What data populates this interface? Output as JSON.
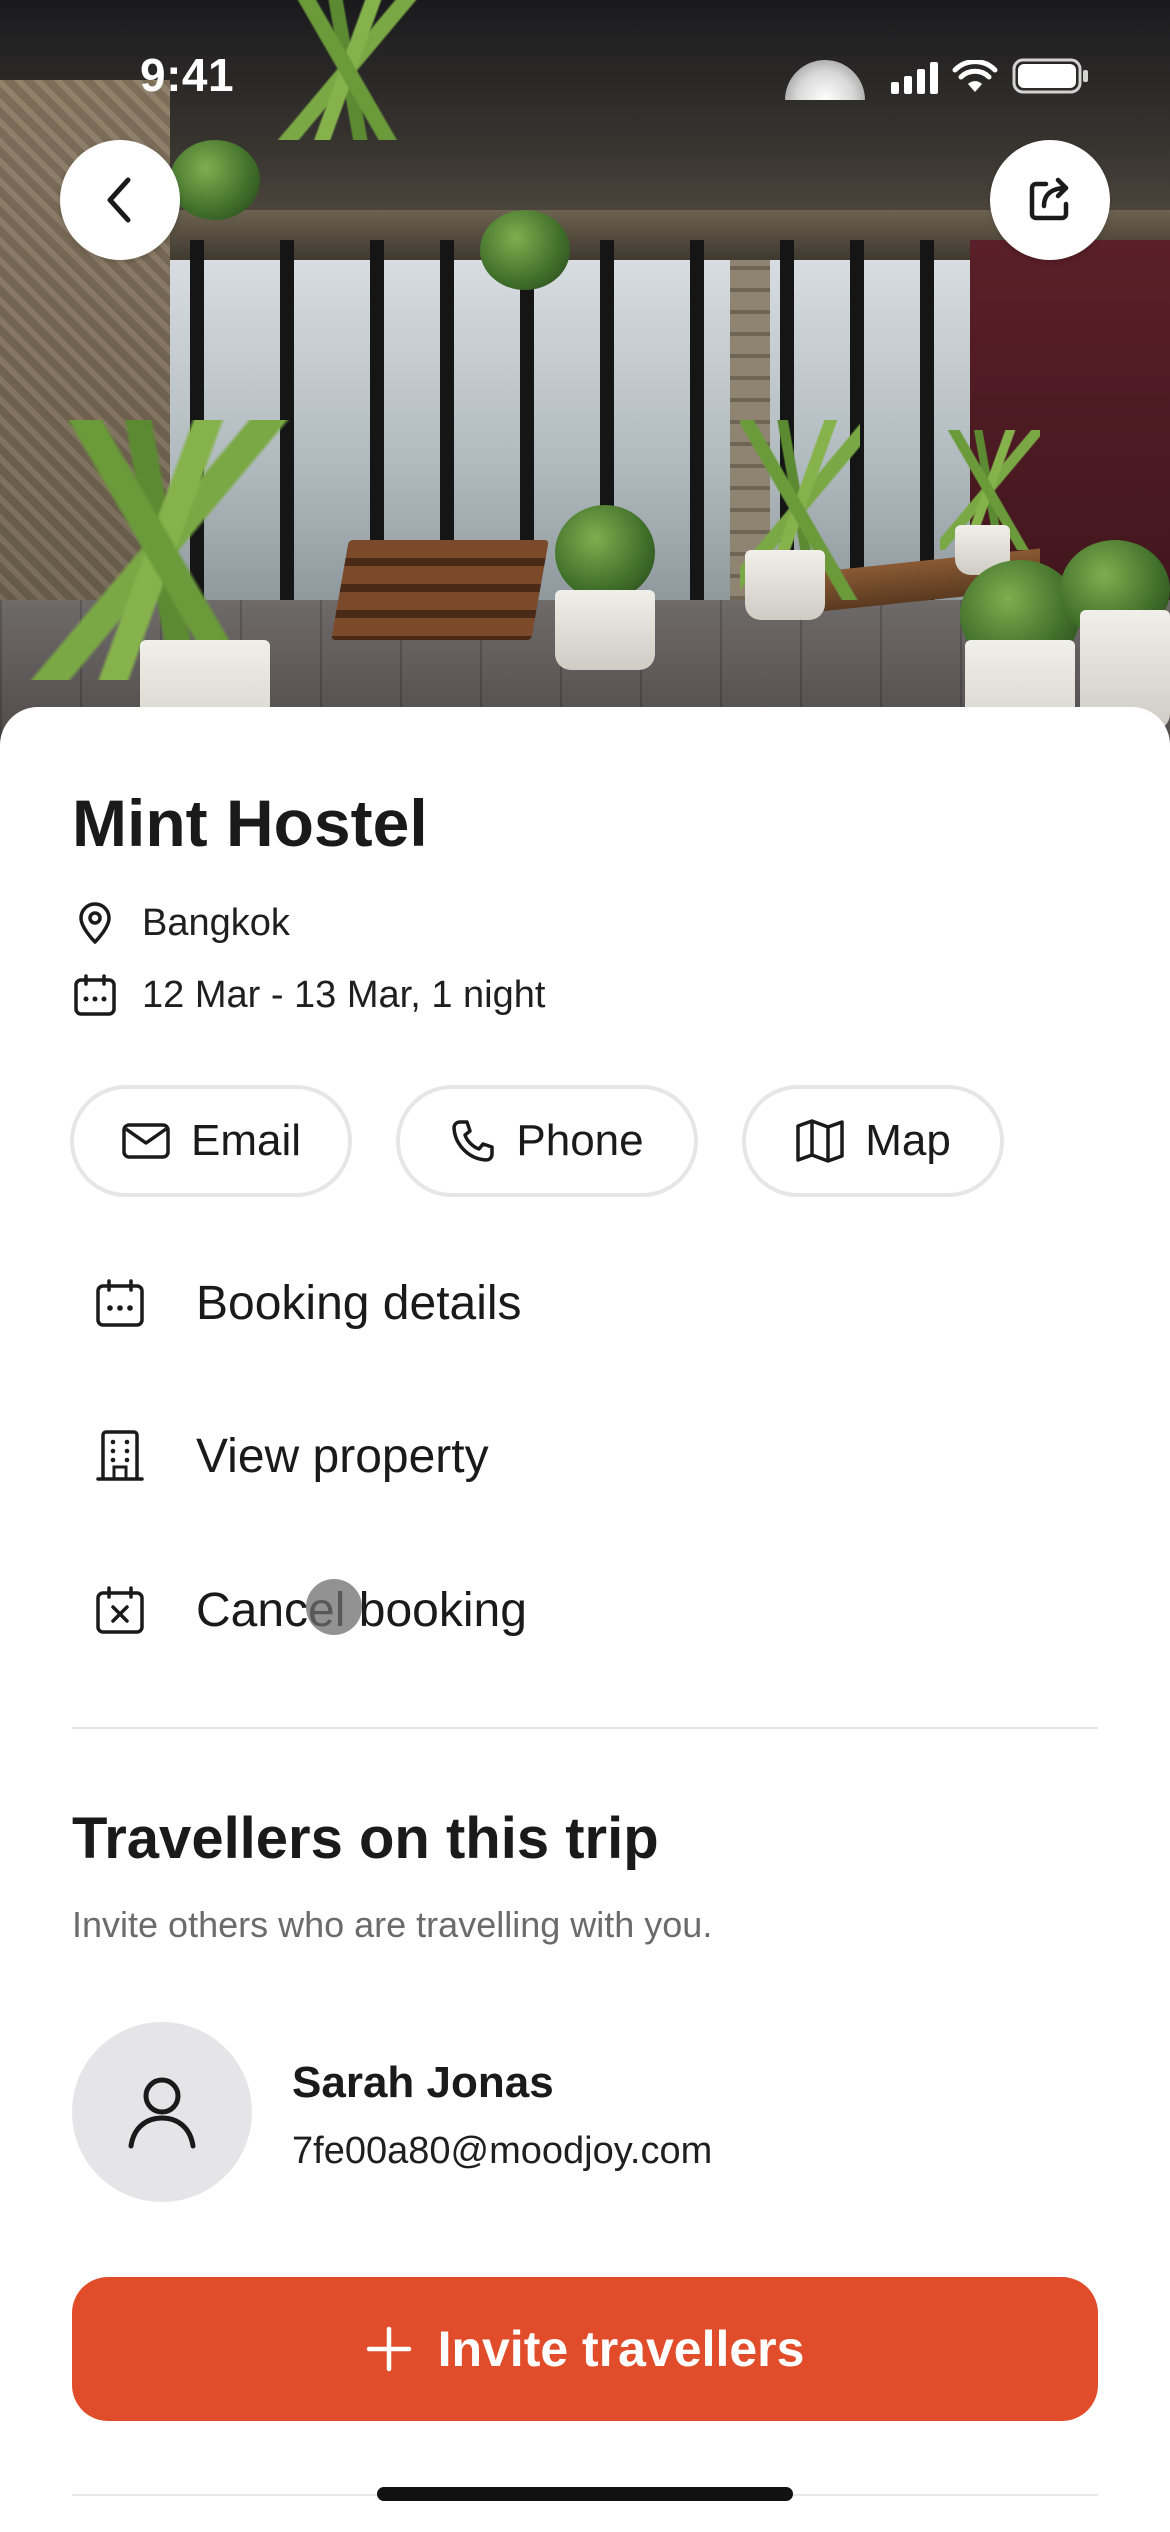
{
  "status_bar": {
    "time": "9:41"
  },
  "header": {
    "back_icon": "chevron-left-icon",
    "share_icon": "share-icon"
  },
  "property": {
    "name": "Mint Hostel",
    "location": "Bangkok",
    "dates": "12 Mar - 13 Mar, 1 night"
  },
  "contact_chips": {
    "email_label": "Email",
    "phone_label": "Phone",
    "map_label": "Map"
  },
  "actions": {
    "booking_details": "Booking details",
    "view_property": "View property",
    "cancel_booking": "Cancel booking"
  },
  "travellers": {
    "title": "Travellers on this trip",
    "subtitle": "Invite others who are travelling with you.",
    "list": [
      {
        "name": "Sarah Jonas",
        "email": "7fe00a80@moodjoy.com"
      }
    ],
    "invite_label": "Invite travellers"
  },
  "colors": {
    "accent": "#e14d2a",
    "chip_border": "#e6e6e6",
    "avatar_bg": "#e5e5e7",
    "subtext": "#6b6b6b"
  }
}
